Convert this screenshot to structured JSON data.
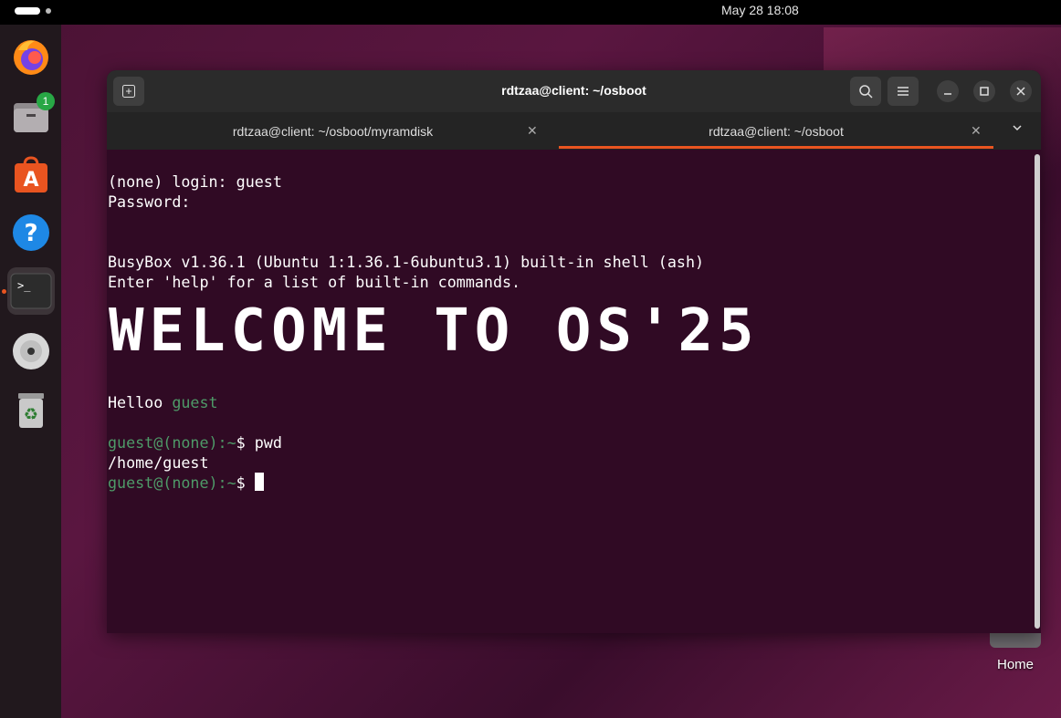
{
  "topbar": {
    "clock": "May 28  18:08"
  },
  "dock": {
    "items": [
      {
        "name": "firefox-icon"
      },
      {
        "name": "files-icon",
        "badge": "1"
      },
      {
        "name": "app-center-icon"
      },
      {
        "name": "help-icon"
      },
      {
        "name": "terminal-icon"
      },
      {
        "name": "disc-icon"
      },
      {
        "name": "trash-icon"
      }
    ]
  },
  "desktop": {
    "home_label": "Home"
  },
  "window": {
    "title": "rdtzaa@client: ~/osboot",
    "tabs": [
      {
        "label": "rdtzaa@client: ~/osboot/myramdisk"
      },
      {
        "label": "rdtzaa@client: ~/osboot"
      }
    ]
  },
  "terminal": {
    "lines": [
      "(none) login: guest",
      "Password:",
      "BusyBox v1.36.1 (Ubuntu 1:1.36.1-6ubuntu3.1) built-in shell (ash)",
      "Enter 'help' for a list of built-in commands."
    ],
    "banner": "WELCOME TO OS'25",
    "hello_prefix": "Helloo ",
    "hello_name": "guest",
    "prompt": "guest@(none):~",
    "prompt_symbol": "$ ",
    "cmd1": "pwd",
    "output1": "/home/guest"
  },
  "colors": {
    "accent": "#e95420",
    "terminal_bg": "#300a24",
    "prompt_green": "#4e9a68"
  }
}
